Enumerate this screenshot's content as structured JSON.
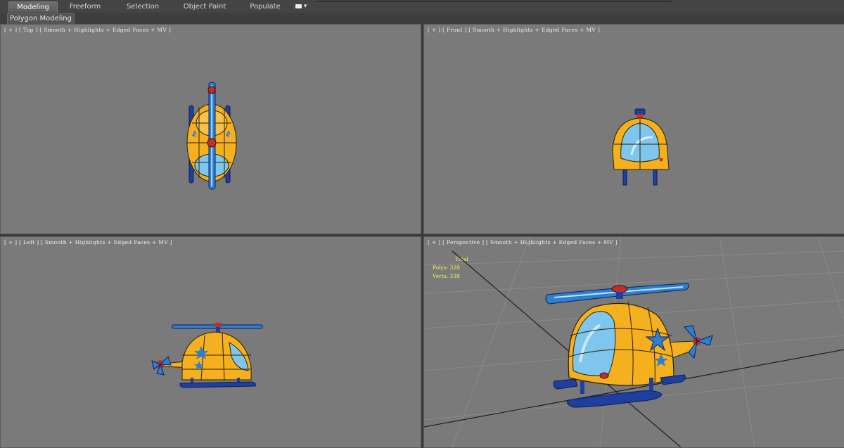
{
  "ribbon": {
    "tabs": [
      {
        "label": "Modeling",
        "active": true
      },
      {
        "label": "Freeform",
        "active": false
      },
      {
        "label": "Selection",
        "active": false
      },
      {
        "label": "Object Paint",
        "active": false
      },
      {
        "label": "Populate",
        "active": false
      }
    ],
    "extra_icon": "dropdown-toggle-icon"
  },
  "panel": {
    "label": "Polygon Modeling"
  },
  "viewports": {
    "top": {
      "label": "[ + ] [ Top ] [ Smooth + Highlights + Edged Faces + MV ]"
    },
    "front": {
      "label": "[ + ] [ Front ] [ Smooth + Highlights + Edged Faces + MV ]"
    },
    "left": {
      "label": "[ + ] [ Left ] [ Smooth + Highlights + Edged Faces + MV ]"
    },
    "perspective": {
      "label": "[ + ] [ Perspective ] [ Smooth + Highlights + Edged Faces + MV ]",
      "stats": {
        "title": "Total",
        "polys_label": "Polys:",
        "polys_value": "328",
        "verts_label": "Verts:",
        "verts_value": "338"
      }
    }
  },
  "colors": {
    "viewport_bg": "#7a7a7a",
    "body_yellow": "#f5b020",
    "glass_blue": "#7fc6ef",
    "rotor_blue": "#2f7fd0",
    "skid_blue": "#1e3fa0",
    "hub_red": "#c0302a",
    "stats_yellow": "#f5f552"
  }
}
